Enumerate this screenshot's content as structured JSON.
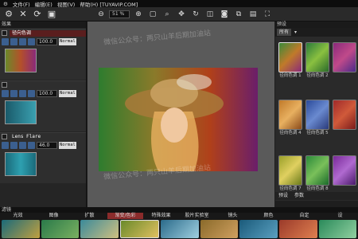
{
  "window_title": "帮助(H) [TUYAVIP.COM]",
  "menu": [
    "文件(F)",
    "编辑(E)",
    "视图(V)",
    "帮助(H) [TUYAVIP.COM]"
  ],
  "toolbar": {
    "zoom": "51 %"
  },
  "left_panel": {
    "title": "效果",
    "layers": [
      {
        "name": "径向色调",
        "opacity": "100.0",
        "mode": "Normal"
      },
      {
        "name": "",
        "opacity": "100.0",
        "mode": "Normal"
      },
      {
        "name": "Lens Flare",
        "opacity": "46.0",
        "mode": "Normal"
      }
    ]
  },
  "right_panel": {
    "title": "预设",
    "dropdown": "所有",
    "presets": [
      "径向色调 1",
      "径向色调 2",
      "径向色调 4",
      "径向色调 5",
      "径向色调 7",
      "径向色调 8"
    ],
    "footer_tabs": [
      "预设",
      "参数"
    ]
  },
  "bottom": {
    "title": "滤镜",
    "categories": [
      "光效",
      "图像",
      "扩散",
      "渐变/色彩",
      "特殊效果",
      "胶片实验室",
      "镜头",
      "颜色",
      "自定",
      "设"
    ],
    "active_category": "渐变/色彩"
  },
  "watermark": [
    "微信公众号：两只山羊后期加油站",
    "微信公众号：两只山羊后期加油站"
  ]
}
